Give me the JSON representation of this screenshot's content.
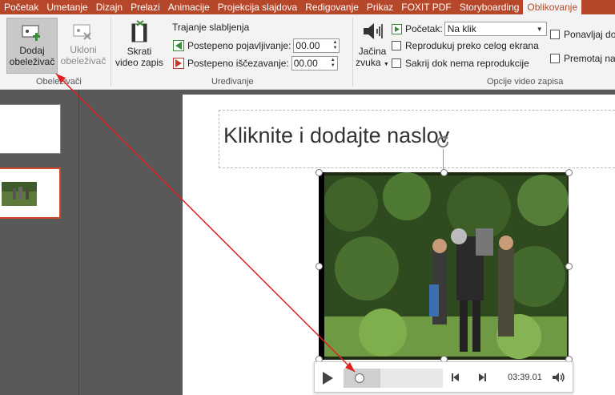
{
  "tabs": [
    "Početak",
    "Umetanje",
    "Dizajn",
    "Prelazi",
    "Animacije",
    "Projekcija slajdova",
    "Redigovanje",
    "Prikaz",
    "FOXIT PDF",
    "Storyboarding",
    "Oblikovanje"
  ],
  "ribbon": {
    "add_bookmark": [
      "Dodaj",
      "obeleživač"
    ],
    "remove_bookmark": [
      "Ukloni",
      "obeleživač"
    ],
    "bookmarks_group": "Obeleživači",
    "trim_video": [
      "Skrati",
      "video zapis"
    ],
    "fade_duration": "Trajanje slabljenja",
    "fade_in_label": "Postepeno pojavljivanje:",
    "fade_in_value": "00.00",
    "fade_out_label": "Postepeno iščezavanje:",
    "fade_out_value": "00.00",
    "editing_group": "Uređivanje",
    "volume": [
      "Jačina",
      "zvuka"
    ],
    "start_label": "Početak:",
    "start_value": "Na klik",
    "play_fullscreen": "Reprodukuj preko celog ekrana",
    "hide_not_playing": "Sakrij dok nema reprodukcije",
    "loop": "Ponavljaj do",
    "rewind": "Premotaj na",
    "video_options_group": "Opcije video zapisa"
  },
  "slide": {
    "title_placeholder": "Kliknite i dodajte naslov"
  },
  "media": {
    "time": "03:39.01",
    "progress": 0.37
  },
  "colors": {
    "tab_bar": "#b7472a",
    "selected_thumb_border": "#d24726",
    "annotation_arrow": "#e02020"
  }
}
